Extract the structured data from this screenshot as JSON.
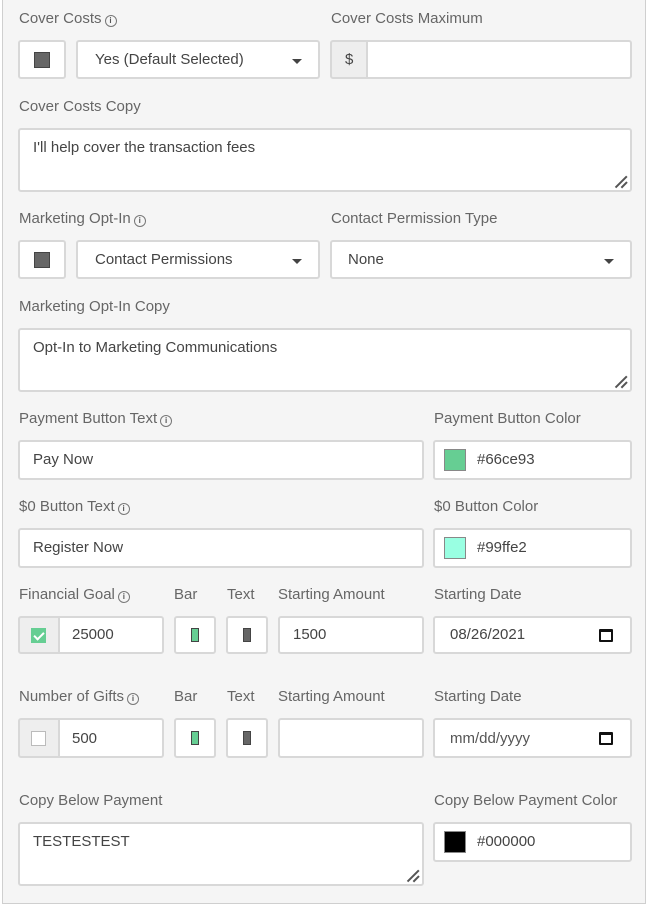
{
  "cover_costs": {
    "label": "Cover Costs",
    "select_value": "Yes (Default Selected)",
    "maximum_label": "Cover Costs Maximum",
    "currency_symbol": "$",
    "maximum_value": "",
    "copy_label": "Cover Costs Copy",
    "copy_value": "I'll help cover the transaction fees"
  },
  "marketing": {
    "label": "Marketing Opt-In",
    "select_value": "Contact Permissions",
    "permission_type_label": "Contact Permission Type",
    "permission_type_value": "None",
    "copy_label": "Marketing Opt-In Copy",
    "copy_value": "Opt-In to Marketing Communications"
  },
  "payment_button": {
    "text_label": "Payment Button Text",
    "text_value": "Pay Now",
    "color_label": "Payment Button Color",
    "color_value": "#66ce93",
    "color": "#66ce93"
  },
  "zero_button": {
    "text_label": "$0 Button Text",
    "text_value": "Register Now",
    "color_label": "$0 Button Color",
    "color_value": "#99ffe2",
    "color": "#99ffe2"
  },
  "financial_goal": {
    "label": "Financial Goal",
    "checked": true,
    "goal_value": "25000",
    "bar_label": "Bar",
    "bar_color": "#66ce93",
    "text_label": "Text",
    "text_color": "#666666",
    "starting_amount_label": "Starting Amount",
    "starting_amount_value": "1500",
    "starting_date_label": "Starting Date",
    "starting_date_value": "08/26/2021"
  },
  "number_of_gifts": {
    "label": "Number of Gifts",
    "checked": false,
    "goal_value": "500",
    "bar_label": "Bar",
    "bar_color": "#66ce93",
    "text_label": "Text",
    "text_color": "#666666",
    "starting_amount_label": "Starting Amount",
    "starting_amount_value": "",
    "starting_date_label": "Starting Date",
    "starting_date_placeholder": "mm/dd/yyyy"
  },
  "copy_below_payment": {
    "label": "Copy Below Payment",
    "value": "TESTESTEST",
    "color_label": "Copy Below Payment Color",
    "color_value": "#000000",
    "color": "#000000"
  },
  "icons": {
    "info": "info-icon",
    "dropdown": "caret-down-icon",
    "calendar": "calendar-icon",
    "resize": "resize-handle-icon",
    "check": "check-icon"
  }
}
